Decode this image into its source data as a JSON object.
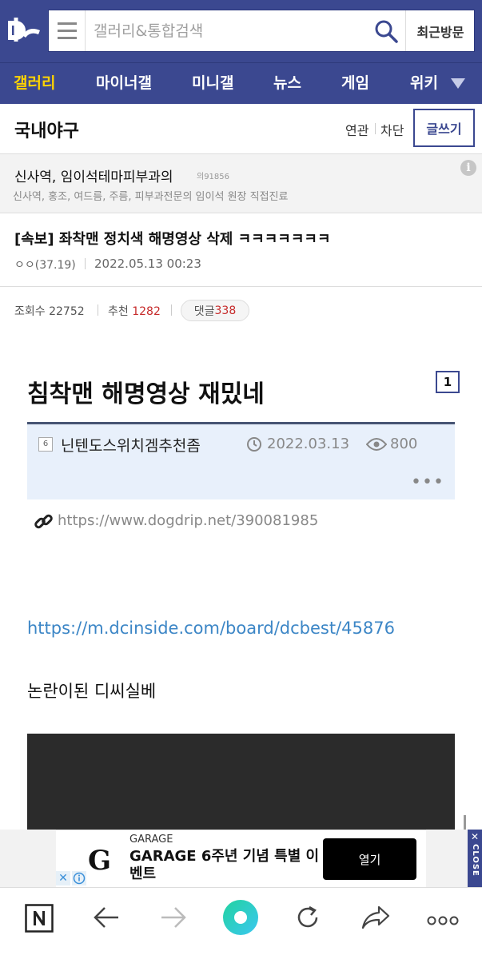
{
  "header": {
    "search_placeholder": "갤러리&통합검색",
    "recent_visits_label": "최근방문"
  },
  "nav": {
    "items": [
      "갤러리",
      "마이너갤",
      "미니갤",
      "뉴스",
      "게임",
      "위키"
    ]
  },
  "gallery": {
    "title": "국내야구",
    "related_label": "연관",
    "block_label": "차단",
    "write_label": "글쓰기"
  },
  "ad": {
    "title": "신사역, 임이석테마피부과의",
    "count": "의91856",
    "description": "신사역, 홍조, 여드름, 주름, 피부과전문의 임이석 원장 직접진료"
  },
  "post": {
    "title": "[속보] 좌착맨 정치색 해명영상 삭제 ㅋㅋㅋㅋㅋㅋㅋ",
    "author": "ㅇㅇ(37.19)",
    "datetime": "2022.05.13 00:23",
    "views_label": "조회수",
    "views": "22752",
    "recommend_label": "추천",
    "recommend": "1282",
    "comments_label": "댓글",
    "comments": "338"
  },
  "content": {
    "heading": "침착맨 해명영상 재밌네",
    "page_badge": "1",
    "embed": {
      "name": "닌텐도스위치겜추천좀",
      "date": "2022.03.13",
      "views": "800",
      "more": "•••"
    },
    "source_link": "https://www.dogdrip.net/390081985",
    "dc_link": "https://m.dcinside.com/board/dcbest/45876",
    "paragraph": "논란이된 디씨실베"
  },
  "banner": {
    "logo": "G",
    "brand": "GARAGE",
    "text": "GARAGE 6주년 기념 특별 이벤트",
    "open_label": "열기",
    "close_label": "CLOSE"
  },
  "colors": {
    "header_bg": "#3b4890",
    "nav_active": "#ffd400",
    "count_red": "#c62a2a",
    "link_blue": "#3c86c6"
  }
}
